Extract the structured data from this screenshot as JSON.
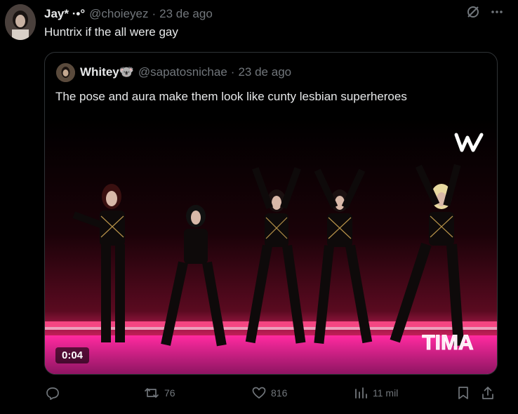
{
  "tweet": {
    "author": {
      "name": "Jay* ·•°",
      "handle": "@choieyez",
      "date": "23 de ago"
    },
    "text": "Huntrix if the all were gay"
  },
  "quote": {
    "author": {
      "name": "Whitey🐨",
      "handle": "@sapatosnichae",
      "date": "23 de ago"
    },
    "text": "The pose and aura make them look like cunty lesbian superheroes",
    "video": {
      "duration": "0:04",
      "watermark": "w",
      "stage_logo": "TIMA"
    }
  },
  "actions": {
    "replies": "",
    "reposts": "76",
    "likes": "816",
    "views": "11 mil"
  },
  "icons": {
    "grok": "grok-icon",
    "more": "more-icon",
    "reply": "reply-icon",
    "repost": "repost-icon",
    "like": "heart-icon",
    "views": "views-icon",
    "bookmark": "bookmark-icon",
    "share": "share-icon"
  },
  "colors": {
    "background": "#000000",
    "text": "#e7e9ea",
    "muted": "#71767b",
    "border": "#2f3336",
    "stage_pink": "#ff2a8a"
  }
}
